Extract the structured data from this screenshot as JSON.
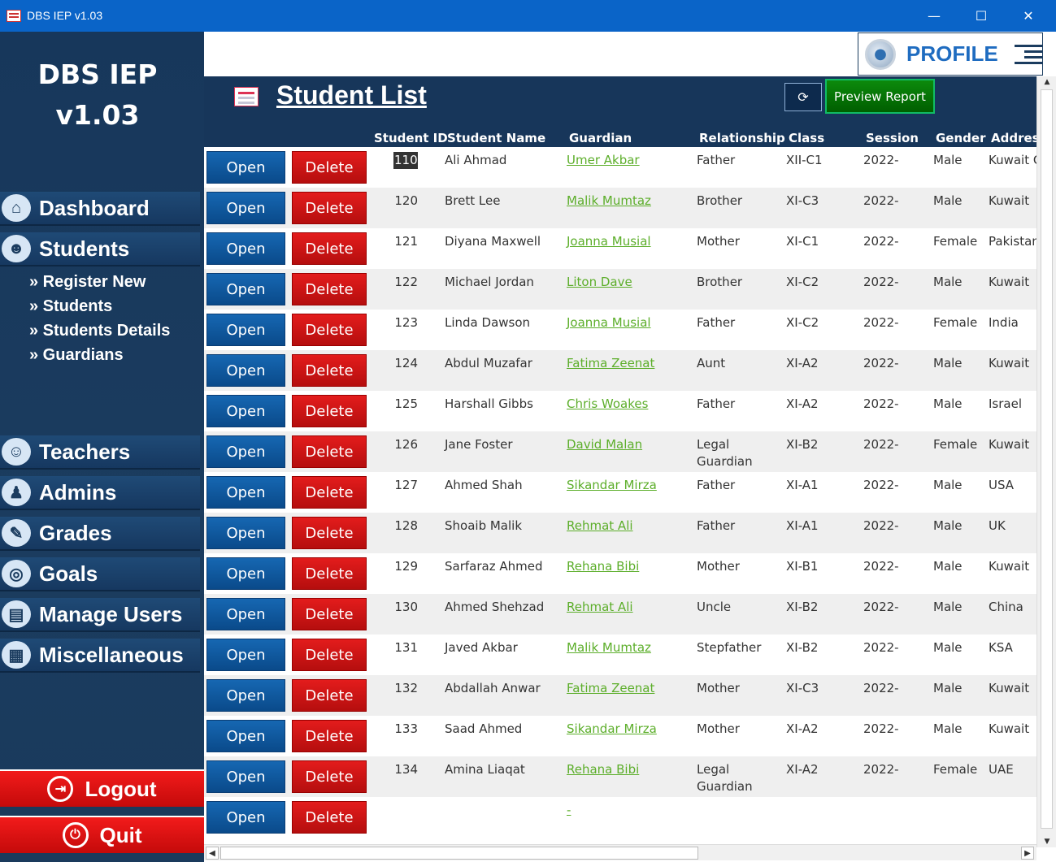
{
  "window": {
    "title": "DBS IEP v1.03",
    "minimize": "—",
    "maximize": "☐",
    "close": "✕"
  },
  "sidebar": {
    "brand_line1": "DBS IEP",
    "brand_line2": "v1.03",
    "items": [
      {
        "label": "Dashboard",
        "icon": "home-icon"
      },
      {
        "label": "Students",
        "icon": "students-icon"
      },
      {
        "label": "Teachers",
        "icon": "teacher-icon"
      },
      {
        "label": "Admins",
        "icon": "admin-icon"
      },
      {
        "label": "Grades",
        "icon": "grades-icon"
      },
      {
        "label": "Goals",
        "icon": "goals-icon"
      },
      {
        "label": "Manage Users",
        "icon": "manage-users-icon"
      },
      {
        "label": "Miscellaneous",
        "icon": "miscellaneous-icon"
      }
    ],
    "subitems": [
      "» Register New",
      "» Students",
      "» Students Details",
      "» Guardians"
    ],
    "logout": "Logout",
    "quit": "Quit"
  },
  "profile": {
    "label": "PROFILE"
  },
  "header": {
    "title": "Student List",
    "preview_report": "Preview Report",
    "columns": [
      "Student ID",
      "Student Name",
      "Guardian",
      "Relationship",
      "Class",
      "Session",
      "Gender",
      "Address"
    ]
  },
  "buttons": {
    "open": "Open",
    "delete": "Delete"
  },
  "rows": [
    {
      "id": "110",
      "name": "Ali Ahmad",
      "guardian": "Umer Akbar",
      "relationship": "Father",
      "class": "XII-C1",
      "session": "2022-",
      "gender": "Male",
      "address": "Kuwait C"
    },
    {
      "id": "120",
      "name": "Brett Lee",
      "guardian": "Malik Mumtaz",
      "relationship": "Brother",
      "class": "XI-C3",
      "session": "2022-",
      "gender": "Male",
      "address": "Kuwait"
    },
    {
      "id": "121",
      "name": "Diyana Maxwell",
      "guardian": "Joanna Musial",
      "relationship": "Mother",
      "class": "XI-C1",
      "session": "2022-",
      "gender": "Female",
      "address": "Pakistan"
    },
    {
      "id": "122",
      "name": "Michael Jordan",
      "guardian": "Liton Dave",
      "relationship": "Brother",
      "class": "XI-C2",
      "session": "2022-",
      "gender": "Male",
      "address": "Kuwait"
    },
    {
      "id": "123",
      "name": "Linda Dawson",
      "guardian": "Joanna Musial",
      "relationship": "Father",
      "class": "XI-C2",
      "session": "2022-",
      "gender": "Female",
      "address": "India"
    },
    {
      "id": "124",
      "name": "Abdul Muzafar",
      "guardian": "Fatima Zeenat",
      "relationship": "Aunt",
      "class": "XI-A2",
      "session": "2022-",
      "gender": "Male",
      "address": "Kuwait"
    },
    {
      "id": "125",
      "name": "Harshall Gibbs",
      "guardian": "Chris Woakes",
      "relationship": "Father",
      "class": "XI-A2",
      "session": "2022-",
      "gender": "Male",
      "address": "Israel"
    },
    {
      "id": "126",
      "name": "Jane Foster",
      "guardian": "David Malan",
      "relationship": "Legal Guardian",
      "class": "XI-B2",
      "session": "2022-",
      "gender": "Female",
      "address": "Kuwait"
    },
    {
      "id": "127",
      "name": "Ahmed Shah",
      "guardian": "Sikandar Mirza",
      "relationship": "Father",
      "class": "XI-A1",
      "session": "2022-",
      "gender": "Male",
      "address": "USA"
    },
    {
      "id": "128",
      "name": "Shoaib Malik",
      "guardian": "Rehmat Ali",
      "relationship": "Father",
      "class": "XI-A1",
      "session": "2022-",
      "gender": "Male",
      "address": "UK"
    },
    {
      "id": "129",
      "name": "Sarfaraz Ahmed",
      "guardian": "Rehana Bibi",
      "relationship": "Mother",
      "class": "XI-B1",
      "session": "2022-",
      "gender": "Male",
      "address": "Kuwait"
    },
    {
      "id": "130",
      "name": "Ahmed Shehzad",
      "guardian": "Rehmat Ali",
      "relationship": "Uncle",
      "class": "XI-B2",
      "session": "2022-",
      "gender": "Male",
      "address": "China"
    },
    {
      "id": "131",
      "name": "Javed Akbar",
      "guardian": "Malik Mumtaz",
      "relationship": "Stepfather",
      "class": "XI-B2",
      "session": "2022-",
      "gender": "Male",
      "address": "KSA"
    },
    {
      "id": "132",
      "name": "Abdallah Anwar",
      "guardian": "Fatima Zeenat",
      "relationship": "Mother",
      "class": "XI-C3",
      "session": "2022-",
      "gender": "Male",
      "address": "Kuwait"
    },
    {
      "id": "133",
      "name": "Saad Ahmed",
      "guardian": "Sikandar Mirza",
      "relationship": "Mother",
      "class": "XI-A2",
      "session": "2022-",
      "gender": "Male",
      "address": "Kuwait"
    },
    {
      "id": "134",
      "name": "Amina Liaqat",
      "guardian": "Rehana Bibi",
      "relationship": "Legal Guardian",
      "class": "XI-A2",
      "session": "2022-",
      "gender": "Female",
      "address": "UAE"
    },
    {
      "id": "",
      "name": "",
      "guardian": "-",
      "relationship": "",
      "class": "",
      "session": "",
      "gender": "",
      "address": ""
    }
  ],
  "colors": {
    "sidebar": "#1b3c5f",
    "accent_blue": "#1f6cc0",
    "delete_red": "#d01414",
    "open_blue": "#0f5aa0",
    "preview_green": "#0a7a0a",
    "guardian_link": "#5cae2a"
  }
}
